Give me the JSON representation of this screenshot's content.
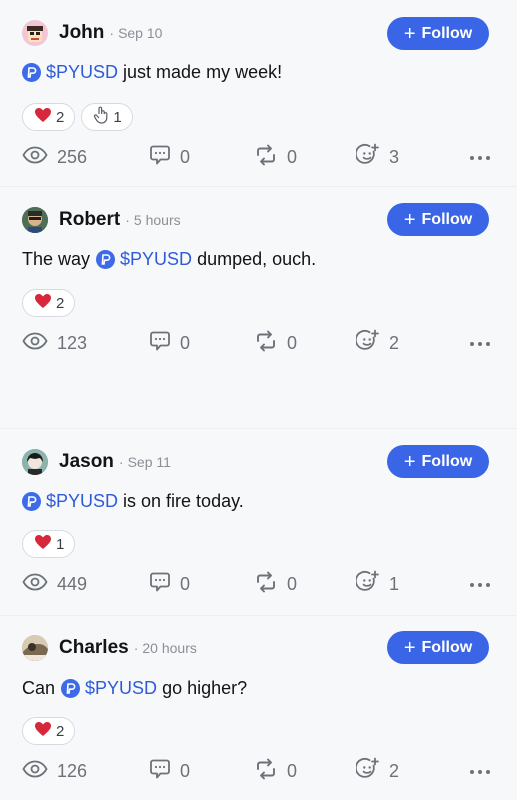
{
  "follow_label": "Follow",
  "dot": "·",
  "accent": "#3a65e6",
  "posts": [
    {
      "author": "John",
      "time": "Sep 10",
      "text_before": "",
      "ticker": "$PYUSD",
      "text_after": "just made my week!",
      "reactions": [
        {
          "icon": "heart-icon",
          "count": "2"
        },
        {
          "icon": "hand-icon",
          "count": "1"
        }
      ],
      "views": "256",
      "comments": "0",
      "reposts": "0",
      "emoji_reacts": "3"
    },
    {
      "author": "Robert",
      "time": "5 hours",
      "text_before": "The way",
      "ticker": "$PYUSD",
      "text_after": "dumped, ouch.",
      "reactions": [
        {
          "icon": "heart-icon",
          "count": "2"
        }
      ],
      "views": "123",
      "comments": "0",
      "reposts": "0",
      "emoji_reacts": "2"
    },
    {
      "author": "Jason",
      "time": "Sep 11",
      "text_before": "",
      "ticker": "$PYUSD",
      "text_after": "is on fire today.",
      "reactions": [
        {
          "icon": "heart-icon",
          "count": "1"
        }
      ],
      "views": "449",
      "comments": "0",
      "reposts": "0",
      "emoji_reacts": "1"
    },
    {
      "author": "Charles",
      "time": "20 hours",
      "text_before": "Can",
      "ticker": "$PYUSD",
      "text_after": "go higher?",
      "reactions": [
        {
          "icon": "heart-icon",
          "count": "2"
        }
      ],
      "views": "126",
      "comments": "0",
      "reposts": "0",
      "emoji_reacts": "2"
    }
  ]
}
